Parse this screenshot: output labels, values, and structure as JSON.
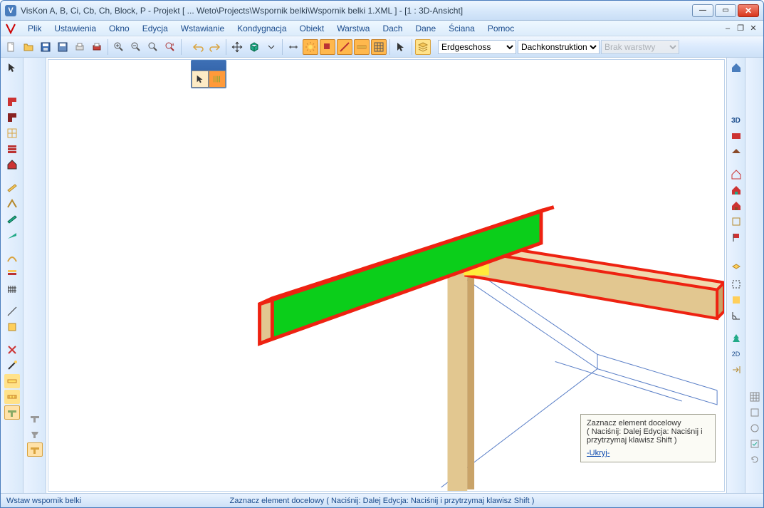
{
  "title": "VisKon A, B, Ci, Cb, Ch, Block, P - Projekt [ ... Weto\\Projects\\Wspornik belki\\Wspornik belki 1.XML ]  -  [1 : 3D-Ansicht]",
  "menu": {
    "plik": "Plik",
    "ustawienia": "Ustawienia",
    "okno": "Okno",
    "edycja": "Edycja",
    "wstawianie": "Wstawianie",
    "kondygnacja": "Kondygnacja",
    "obiekt": "Obiekt",
    "warstwa": "Warstwa",
    "dach": "Dach",
    "dane": "Dane",
    "sciana": "Ściana",
    "pomoc": "Pomoc"
  },
  "combos": {
    "floor": "Erdgeschoss",
    "construction": "Dachkonstruktion",
    "layer": "Brak warstwy"
  },
  "tooltip": {
    "line1": "Zaznacz element docelowy",
    "line2": "( Naciśnij: Dalej Edycja: Naciśnij i przytrzymaj klawisz Shift )",
    "hide": "-Ukryj-"
  },
  "status": {
    "left": "Wstaw wspornik belki",
    "center": "Zaznacz element docelowy ( Naciśnij: Dalej Edycja: Naciśnij i przytrzymaj klawisz Shift )"
  },
  "icons": {
    "right_3d": "3D"
  }
}
